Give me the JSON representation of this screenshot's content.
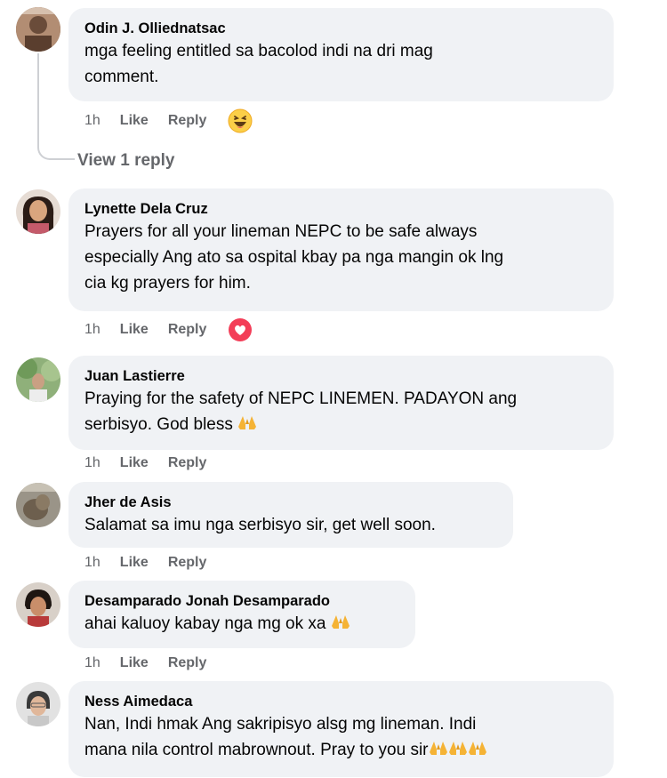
{
  "comments": [
    {
      "author": "Odin J. Olliednatsac",
      "lines": [
        "mga feeling entitled sa bacolod indi na dri mag",
        "comment."
      ],
      "time": "1h",
      "like": "Like",
      "reply": "Reply",
      "reaction": "haha-icon"
    },
    {
      "author": "Lynette Dela Cruz",
      "lines": [
        "Prayers for all your lineman NEPC to be safe always",
        "especially Ang ato sa ospital kbay pa nga mangin ok lng",
        "cia kg prayers for him."
      ],
      "time": "1h",
      "like": "Like",
      "reply": "Reply",
      "reaction": "love-icon"
    },
    {
      "author": "Juan Lastierre",
      "lines": [
        "Praying for the safety of NEPC LINEMEN. PADAYON ang",
        "serbisyo. God bless"
      ],
      "time": "1h",
      "like": "Like",
      "reply": "Reply"
    },
    {
      "author": "Jher de Asis",
      "lines": [
        "Salamat sa imu nga serbisyo sir, get well soon."
      ],
      "time": "1h",
      "like": "Like",
      "reply": "Reply"
    },
    {
      "author": "Desamparado Jonah Desamparado",
      "lines": [
        "ahai kaluoy kabay nga mg ok xa"
      ],
      "time": "1h",
      "like": "Like",
      "reply": "Reply"
    },
    {
      "author": "Ness Aimedaca",
      "lines": [
        "Nan, Indi hmak Ang sakripisyo alsg mg lineman. Indi",
        "mana nila control mabrownout. Pray to you sir"
      ],
      "time": "",
      "like": "",
      "reply": ""
    }
  ],
  "view_reply_label": "View 1 reply",
  "colors": {
    "bubble": "#f0f2f5",
    "meta": "#65676b",
    "text": "#050505",
    "love": "#f33e58",
    "haha": "#f7b125"
  }
}
